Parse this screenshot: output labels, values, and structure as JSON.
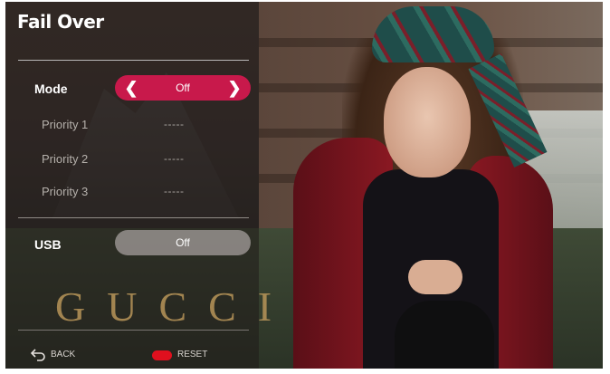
{
  "osd": {
    "title": "Fail Over",
    "mode": {
      "label": "Mode",
      "value": "Off"
    },
    "priorities": [
      {
        "label": "Priority 1",
        "value": "-----"
      },
      {
        "label": "Priority 2",
        "value": "-----"
      },
      {
        "label": "Priority 3",
        "value": "-----"
      }
    ],
    "usb": {
      "label": "USB",
      "value": "Off"
    },
    "brand": "GUCCI",
    "footer": {
      "back_label": "BACK",
      "reset_label": "RESET"
    }
  },
  "colors": {
    "accent": "#c8194b",
    "reset_key": "#e0101e",
    "usb_pill": "#96918e"
  },
  "icons": {
    "mode_left": "chevron-left-icon",
    "mode_right": "chevron-right-icon",
    "back": "back-arrow-icon"
  }
}
